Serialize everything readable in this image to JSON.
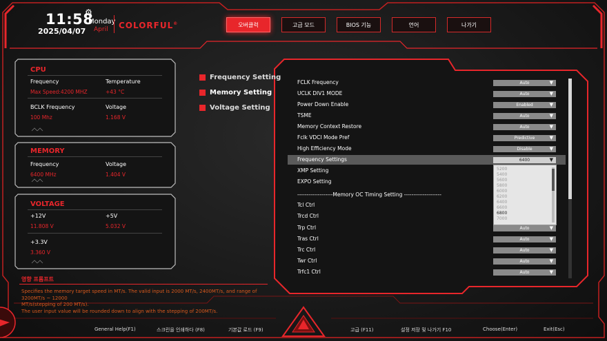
{
  "header": {
    "time": "11:58",
    "day": "Monday",
    "date": "2025/04/07",
    "month": "April",
    "brand": "COLORFUL",
    "brand_mark": "®"
  },
  "tabs": [
    {
      "label": "오버클럭",
      "active": true
    },
    {
      "label": "고급 모드",
      "active": false
    },
    {
      "label": "BIOS 기능",
      "active": false
    },
    {
      "label": "언어",
      "active": false
    },
    {
      "label": "나가기",
      "active": false
    }
  ],
  "cpu": {
    "title": "CPU",
    "frequency_label": "Frequency",
    "frequency_value": "Max Speed:4200 MHZ",
    "temperature_label": "Temperature",
    "temperature_value": "+43 °C",
    "bclk_label": "BCLK Frequency",
    "bclk_value": "100 Mhz",
    "voltage_label": "Voltage",
    "voltage_value": "1.168 V"
  },
  "memory": {
    "title": "MEMORY",
    "frequency_label": "Frequency",
    "frequency_value": "6400 MHz",
    "voltage_label": "Voltage",
    "voltage_value": "1.404 V"
  },
  "voltage": {
    "title": "VOLTAGE",
    "v12_label": "+12V",
    "v12_value": "11.808 V",
    "v5_label": "+5V",
    "v5_value": "5.032 V",
    "v33_label": "+3.3V",
    "v33_value": "3.360 V"
  },
  "hint": {
    "title": "영향 프롬프트",
    "line1": "Specifies the memory target speed in MT/s. The valid input is 2000 MT/s, 2400MT/s, and range of 3200MT/s ~ 12000",
    "line2": "MT/s(stepping of 200 MT/s).",
    "line3": "The user input value will be rounded down to align with the stepping of 200MT/s."
  },
  "mid_menu": [
    {
      "label": "Frequency Setting",
      "active": false
    },
    {
      "label": "Memory Setting",
      "active": true
    },
    {
      "label": "Voltage Setting",
      "active": false
    }
  ],
  "settings": [
    {
      "name": "FCLK Frequency",
      "value": "Auto"
    },
    {
      "name": "UCLK DIV1 MODE",
      "value": "Auto"
    },
    {
      "name": "Power Down Enable",
      "value": "Enabled"
    },
    {
      "name": "TSME",
      "value": "Auto"
    },
    {
      "name": "Memory Context Restore",
      "value": "Auto"
    },
    {
      "name": "Fclk VDCI Mode Pref",
      "value": "Predictive"
    },
    {
      "name": "High Efficiency Mode",
      "value": "Disable"
    },
    {
      "name": "Frequency Settings",
      "value": "6400",
      "selected": true
    },
    {
      "name": "XMP Setting",
      "value": ""
    },
    {
      "name": "EXPO Setting",
      "value": ""
    }
  ],
  "timing_divider": "-------------------Memory OC Timing Setting --------------------",
  "timings": [
    {
      "name": "Tcl Ctrl",
      "value": ""
    },
    {
      "name": "Trcd Ctrl",
      "value": ""
    },
    {
      "name": "Trp Ctrl",
      "value": "Auto"
    },
    {
      "name": "Tras Ctrl",
      "value": "Auto"
    },
    {
      "name": "Trc Ctrl",
      "value": "Auto"
    },
    {
      "name": "Twr Ctrl",
      "value": "Auto"
    },
    {
      "name": "Trfc1 Ctrl",
      "value": "Auto"
    }
  ],
  "dropdown_options": [
    "5200",
    "5400",
    "5600",
    "5800",
    "6000",
    "6200",
    "6400",
    "6600",
    "6800",
    "7000"
  ],
  "dropdown_current": "6800",
  "footer": [
    "General Help(F1)",
    "스크린을 인쇄하다 (F8)",
    "기본값 로드 (F9)",
    "고급 (F11)",
    "설정 저장 및 나가기 F10",
    "Choose(Enter)",
    "Exit(Esc)"
  ],
  "colors": {
    "accent": "#e8262b",
    "hint": "#d9591d",
    "background": "#1a1a1a"
  }
}
